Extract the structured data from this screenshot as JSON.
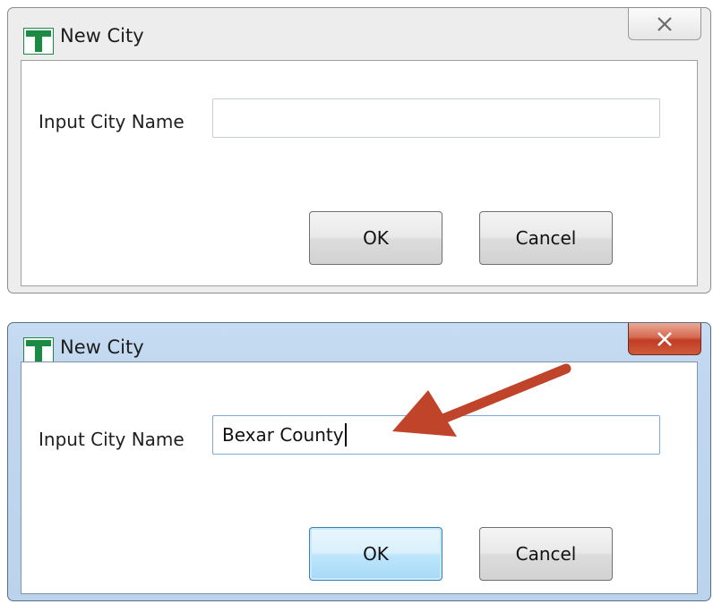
{
  "dialogs": [
    {
      "state": "inactive",
      "title": "New City",
      "close_glyph": "✕",
      "field_label": "Input City Name",
      "input_value": "",
      "ok_label": "OK",
      "cancel_label": "Cancel"
    },
    {
      "state": "active",
      "title": "New City",
      "close_glyph": "✕",
      "field_label": "Input City Name",
      "input_value": "Bexar County",
      "ok_label": "OK",
      "cancel_label": "Cancel"
    }
  ],
  "icons": {
    "app": "app-t-icon",
    "close": "close-icon",
    "annotation": "red-arrow-annotation"
  },
  "colors": {
    "app_icon_green": "#1b8a43",
    "arrow_red": "#c0442a",
    "close_active_red": "#c94a30",
    "active_titlebar": "#c2d8ef"
  }
}
